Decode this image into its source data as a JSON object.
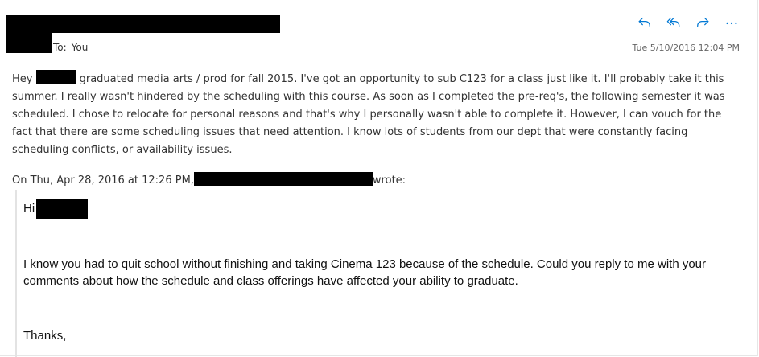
{
  "header": {
    "to_label": "To:",
    "recipient": "You",
    "timestamp": "Tue 5/10/2016 12:04 PM",
    "actions": [
      {
        "name": "reply",
        "icon": "reply-icon"
      },
      {
        "name": "reply-all",
        "icon": "reply-all-icon"
      },
      {
        "name": "forward",
        "icon": "forward-icon"
      },
      {
        "name": "more",
        "icon": "more-icon"
      }
    ]
  },
  "message": {
    "greeting": "Hey",
    "body_after_name": "graduated media arts / prod for fall 2015. I've got an opportunity to sub C123 for a class just like it. I'll probably take it this summer. I really wasn't hindered by the scheduling with this course. As soon as I completed the pre-req's, the following semester it was scheduled. I chose to relocate for personal reasons and that's why I personally wasn't able to complete it. However, I can vouch for the fact that there are some scheduling issues that need attention. I know lots of students from our dept that were constantly facing scheduling conflicts, or availability issues."
  },
  "quoted": {
    "header_prefix": "On Thu, Apr 28, 2016 at 12:26 PM,",
    "header_suffix": "wrote:",
    "greeting": "Hi",
    "paragraph": "I know you had to quit school without finishing and taking Cinema 123 because of the schedule.  Could you reply to me with your comments about how the schedule and class offerings have affected your ability to graduate.",
    "signoff": "Thanks,"
  },
  "colors": {
    "accent": "#0078d4",
    "text": "#333333",
    "quote_bar": "#e3e3e3",
    "redaction": "#000000"
  }
}
